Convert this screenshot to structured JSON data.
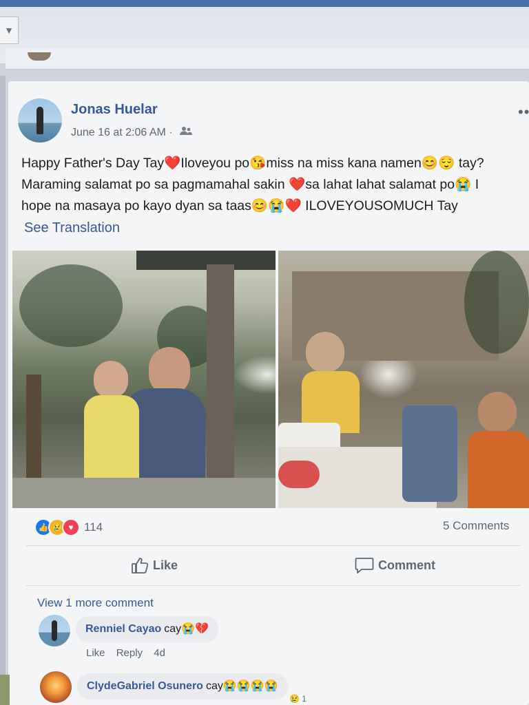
{
  "post": {
    "author": "Jonas Huelar",
    "timestamp": "June 16 at 2:06 AM",
    "separator": "·",
    "text_lines": [
      "Happy Father's Day Tay❤️Iloveyou po😘miss na miss kana namen😊😌 tay?",
      "Maraming salamat po sa pagmamahal sakin ❤️sa lahat lahat salamat po😭 I",
      "hope na masaya po kayo dyan sa taas😊😭❤️ ILOVEYOUSOMUCH Tay"
    ],
    "see_translation": "See Translation",
    "reaction_count": "114",
    "comments_count": "5 Comments"
  },
  "actions": {
    "like": "Like",
    "comment": "Comment"
  },
  "comments": {
    "view_more": "View 1 more comment",
    "items": [
      {
        "name": "Renniel Cayao",
        "text": "cay😭💔",
        "like": "Like",
        "reply": "Reply",
        "age": "4d"
      },
      {
        "name": "ClydeGabriel Osunero",
        "text": "cay😭😭😭😭",
        "reaction_count": "1"
      }
    ]
  },
  "icons": [
    "chevron-down-icon",
    "friends-audience-icon",
    "more-options-icon",
    "like-reaction-icon",
    "sad-reaction-icon",
    "love-reaction-icon",
    "thumbs-up-icon",
    "comment-bubble-icon"
  ],
  "colors": {
    "link_blue": "#385898",
    "like_blue": "#1877f2",
    "love_red": "#f33e58",
    "sad_yellow": "#f7b125",
    "secondary_text": "#606770"
  }
}
